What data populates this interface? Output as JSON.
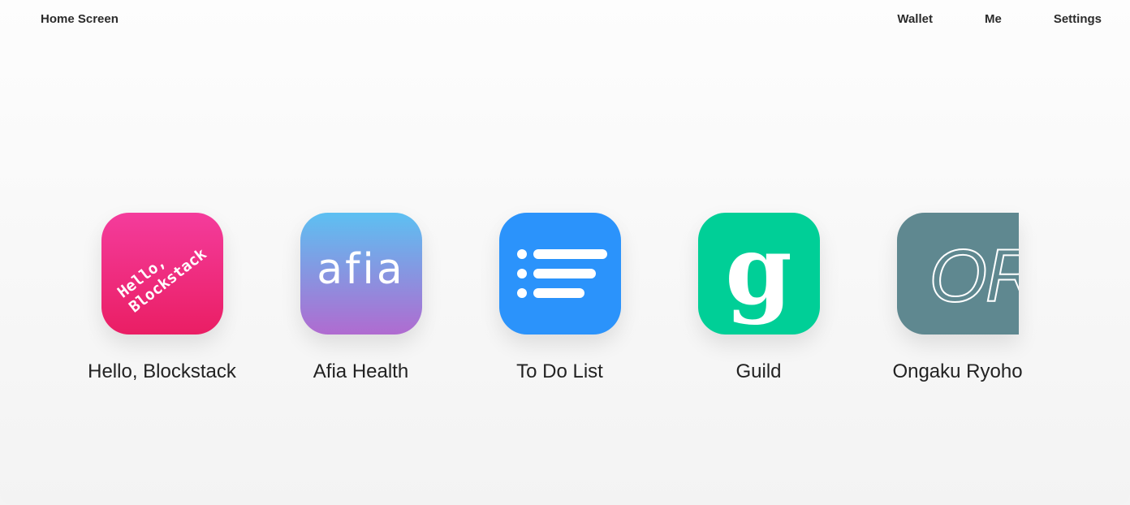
{
  "nav": {
    "home_label": "Home Screen",
    "wallet_label": "Wallet",
    "me_label": "Me",
    "settings_label": "Settings"
  },
  "apps": [
    {
      "label": "Hello, Blockstack",
      "icon": "hello-blockstack-icon",
      "icon_text": "Hello,\nBlockstack",
      "color": "#ea1e64"
    },
    {
      "label": "Afia Health",
      "icon": "afia-health-icon",
      "icon_text": "afia",
      "color": "#b06bd0"
    },
    {
      "label": "To Do List",
      "icon": "todo-list-icon",
      "color": "#2b93fb"
    },
    {
      "label": "Guild",
      "icon": "guild-icon",
      "icon_text": "g",
      "color": "#00cf97"
    },
    {
      "label": "Ongaku Ryoho",
      "icon": "ongaku-ryoho-icon",
      "icon_text": "OR",
      "color": "#5f8890"
    }
  ]
}
